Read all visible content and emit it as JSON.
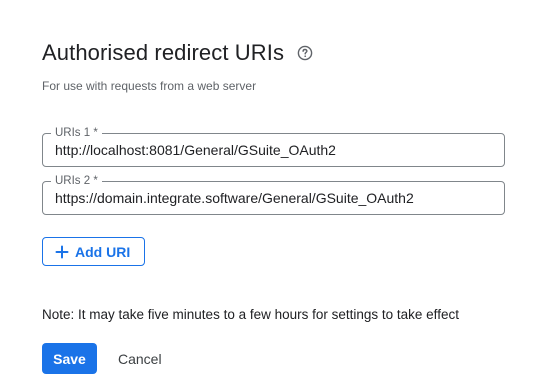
{
  "section": {
    "title": "Authorised redirect URIs",
    "help_icon": "help-circle-icon",
    "subtitle": "For use with requests from a web server"
  },
  "uris": [
    {
      "label": "URIs 1 *",
      "value": "http://localhost:8081/General/GSuite_OAuth2"
    },
    {
      "label": "URIs 2 *",
      "value": "https://domain.integrate.software/General/GSuite_OAuth2"
    }
  ],
  "add_uri": {
    "icon": "plus-icon",
    "label": "Add URI"
  },
  "note": "Note: It may take five minutes to a few hours for settings to take effect",
  "actions": {
    "save_label": "Save",
    "cancel_label": "Cancel"
  },
  "colors": {
    "accent": "#1a73e8",
    "text": "#202124",
    "muted": "#5f6368",
    "border": "#80868b"
  }
}
